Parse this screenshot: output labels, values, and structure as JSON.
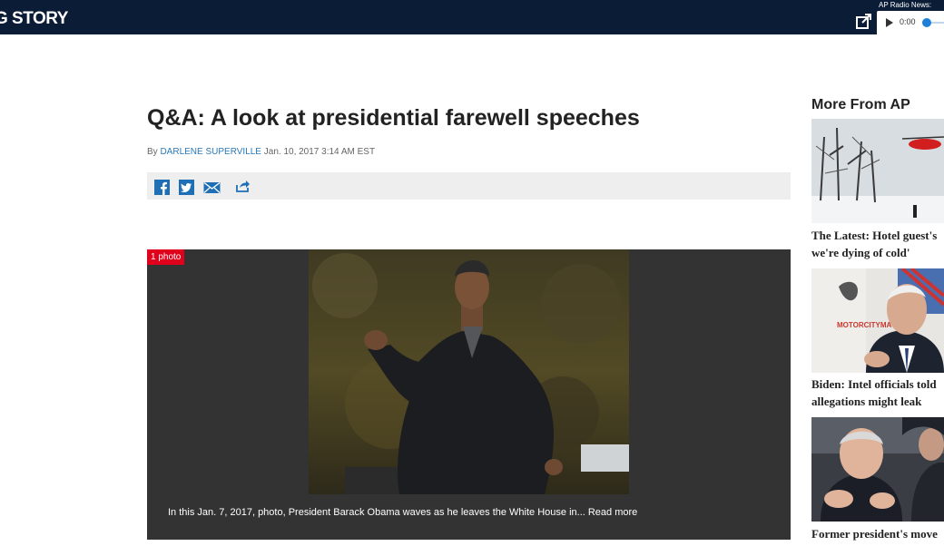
{
  "header": {
    "brand": "G STORY",
    "radio_label": "AP Radio News:",
    "time": "0:00"
  },
  "article": {
    "headline": "Q&A: A look at presidential farewell speeches",
    "by_prefix": "By",
    "author": "DARLENE SUPERVILLE",
    "date": "Jan. 10, 2017 3:14 AM EST",
    "share_icons": [
      "facebook-icon",
      "twitter-icon",
      "email-icon",
      "share-icon"
    ]
  },
  "photo": {
    "badge": "1 photo",
    "caption": "In this Jan. 7, 2017, photo, President Barack Obama waves as he leaves the White House in... Read more"
  },
  "sidebar": {
    "title": "More From AP",
    "items": [
      {
        "line1": "The Latest: Hotel guest's",
        "line2": "we're dying of cold'"
      },
      {
        "line1": "Biden: Intel officials told",
        "line2": "allegations might leak"
      },
      {
        "line1": "Former president's move",
        "line2": ""
      }
    ],
    "logo_text": "MOTORCITYMATCH"
  },
  "colors": {
    "topbar": "#0b1d36",
    "link": "#2a7ab8",
    "badge": "#e1001b",
    "photo_bg": "#333333",
    "share_bar": "#eeeeee",
    "social_blue": "#1e6fb5"
  }
}
